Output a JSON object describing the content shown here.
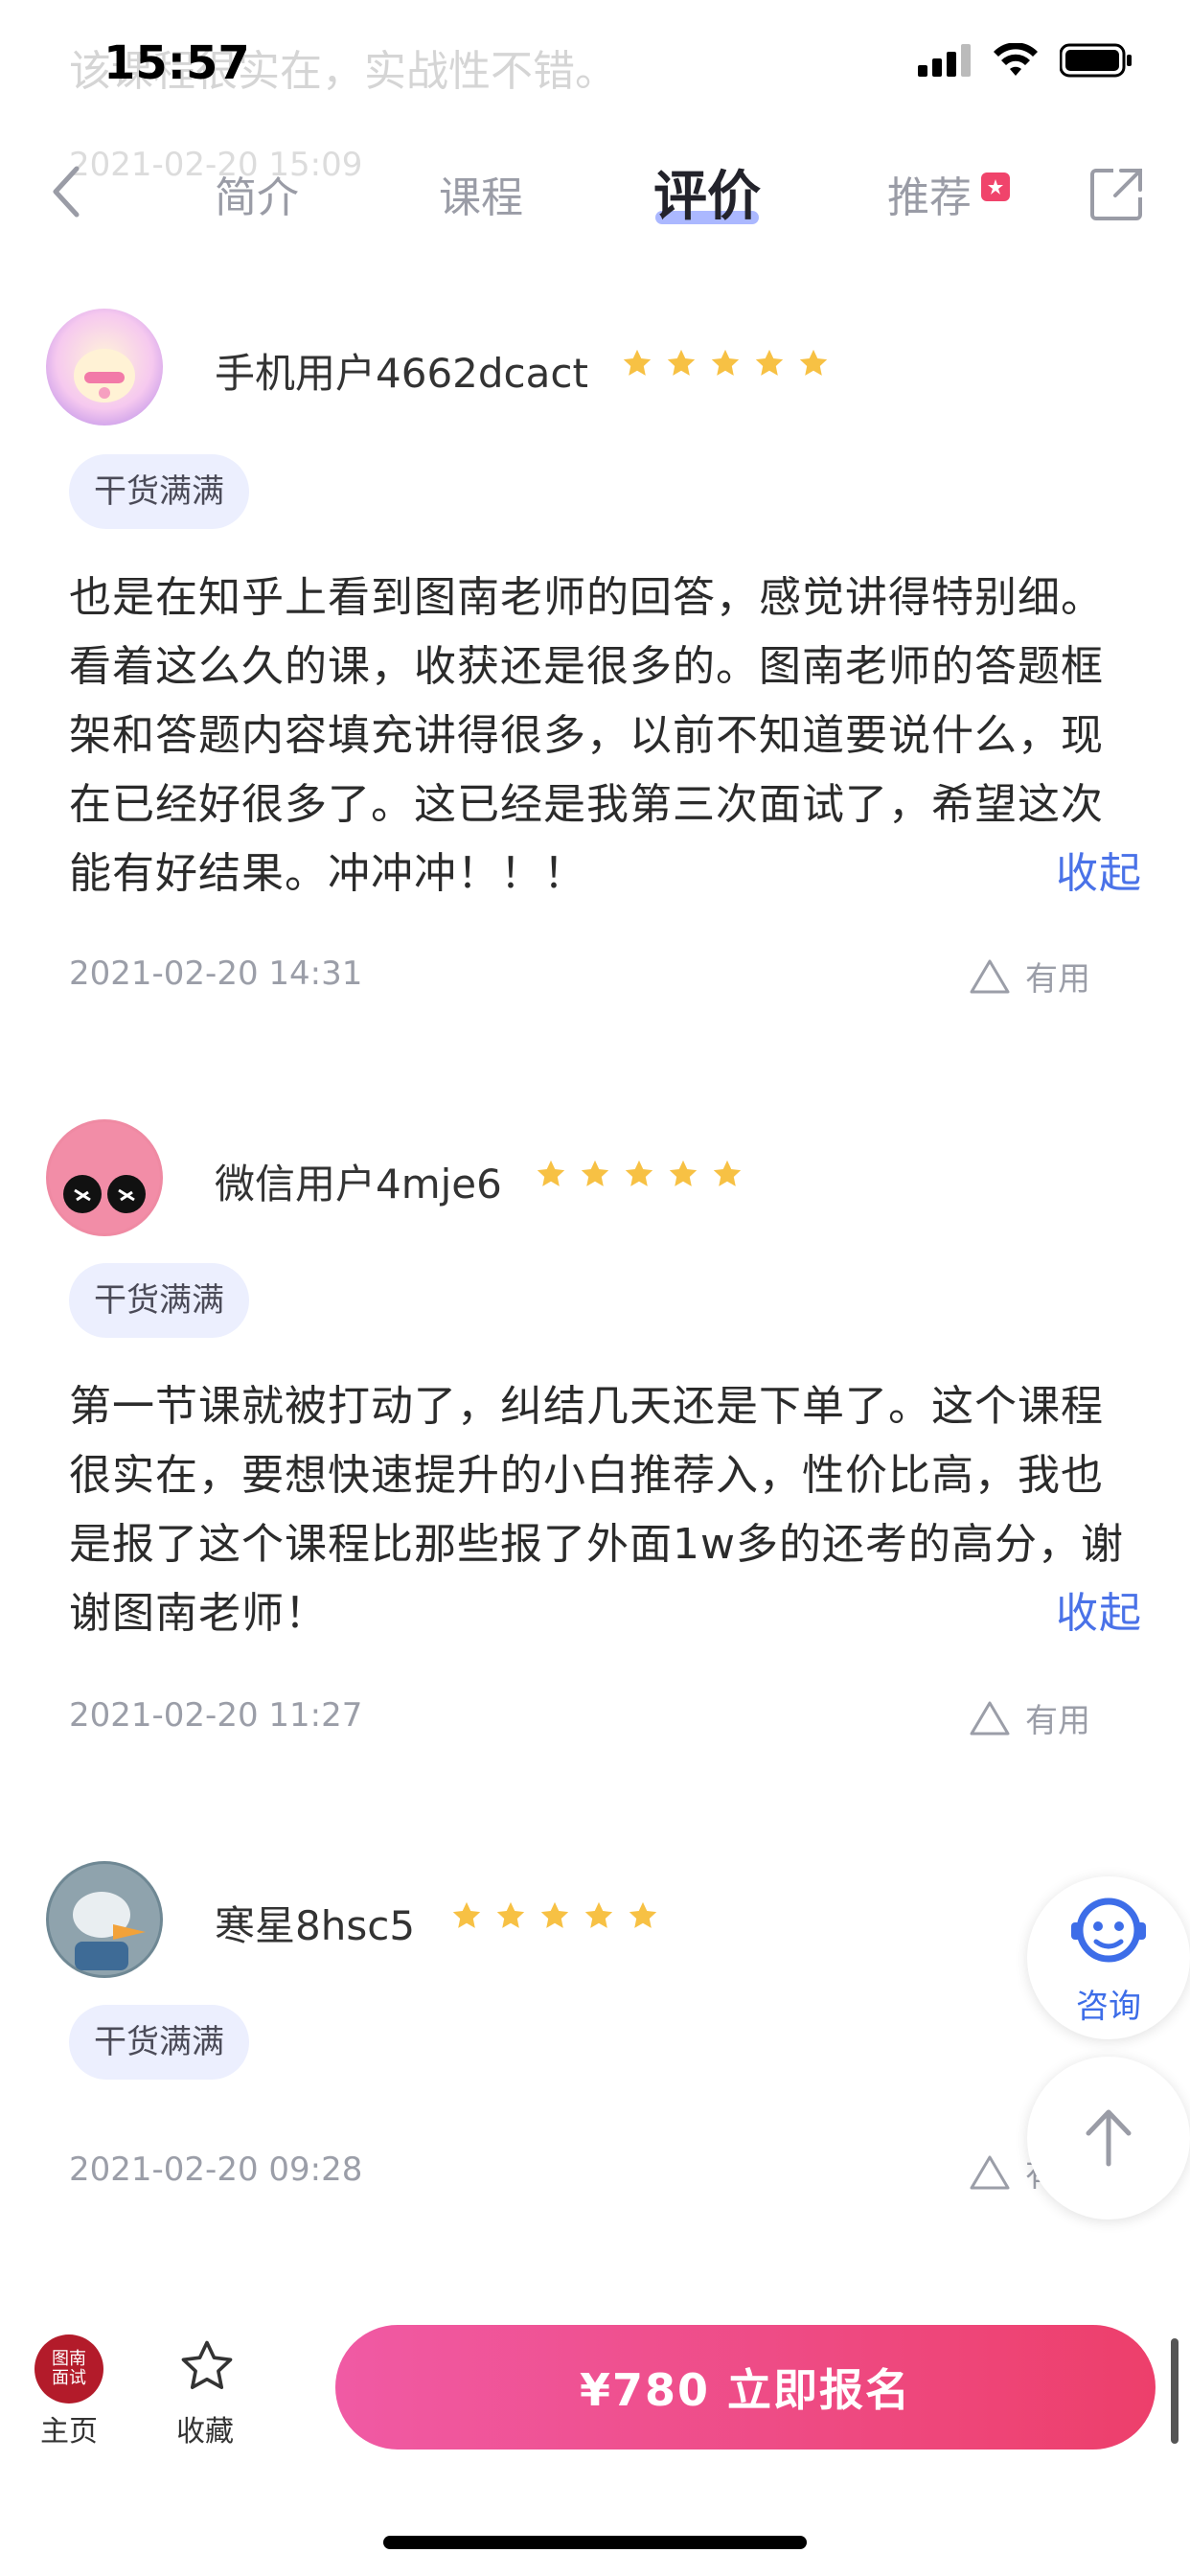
{
  "status_bar": {
    "time": "15:57"
  },
  "ghost_behind": {
    "text": "该课程很实在，实战性不错。",
    "date": "2021-02-20 15:09"
  },
  "nav": {
    "tabs": [
      {
        "label": "简介",
        "active": false
      },
      {
        "label": "课程",
        "active": false
      },
      {
        "label": "评价",
        "active": true
      },
      {
        "label": "推荐",
        "active": false
      }
    ]
  },
  "reviews": [
    {
      "username": "手机用户4662dcact",
      "rating": 5,
      "tag": "干货满满",
      "text": "也是在知乎上看到图南老师的回答，感觉讲得特别细。看着这么久的课，收获还是很多的。图南老师的答题框架和答题内容填充讲得很多，以前不知道要说什么，现在已经好很多了。这已经是我第三次面试了，希望这次能有好结果。冲冲冲！！！",
      "collapse_label": "收起",
      "date": "2021-02-20 14:31",
      "useful_label": "有用"
    },
    {
      "username": "微信用户4mje6",
      "rating": 5,
      "tag": "干货满满",
      "text": "第一节课就被打动了，纠结几天还是下单了。这个课程很实在，要想快速提升的小白推荐入，性价比高，我也是报了这个课程比那些报了外面1w多的还考的高分，谢谢图南老师！",
      "collapse_label": "收起",
      "date": "2021-02-20 11:27",
      "useful_label": "有用"
    },
    {
      "username": "寒星8hsc5",
      "rating": 5,
      "tag": "干货满满",
      "date": "2021-02-20 09:28",
      "useful_label": "有用"
    }
  ],
  "floating": {
    "consult_label": "咨询"
  },
  "bottom_bar": {
    "home_logo_text": "图南面试",
    "home_label": "主页",
    "favorite_label": "收藏",
    "cta_label": "¥780  立即报名"
  },
  "colors": {
    "accent_blue": "#4a72e8",
    "cta_gradient_start": "#f05aa4",
    "cta_gradient_end": "#ed3f6b",
    "star": "#f7c144",
    "tag_bg": "#eceffe"
  }
}
